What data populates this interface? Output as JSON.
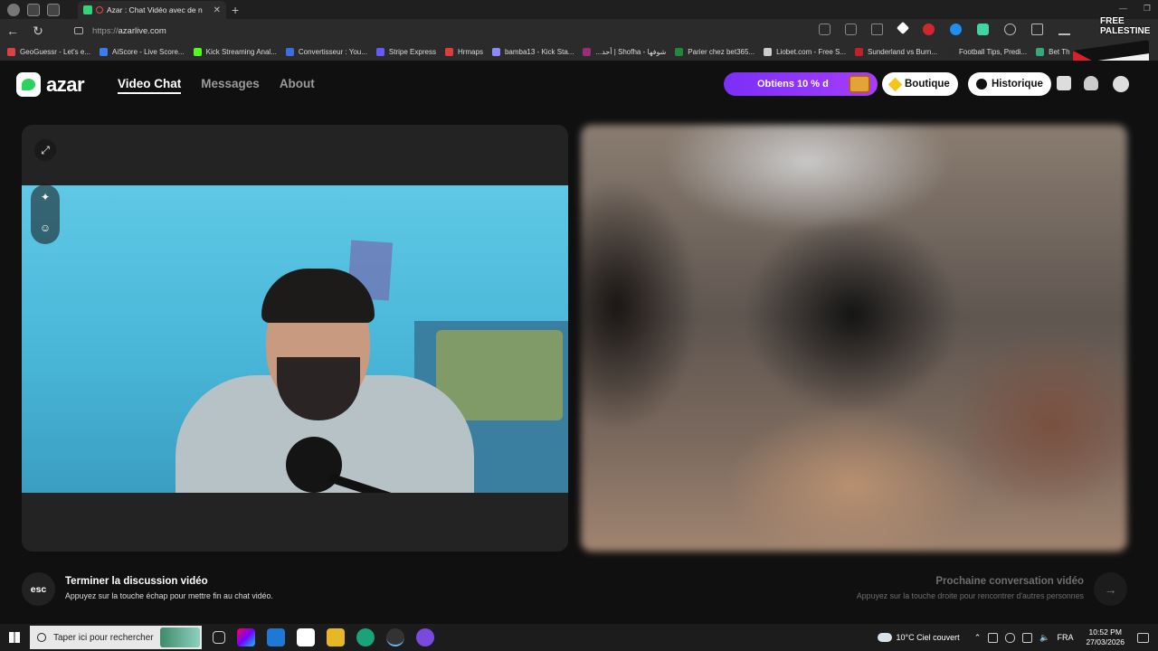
{
  "browser": {
    "tab_title": "Azar : Chat Vidéo avec de n",
    "new_tab_symbol": "+",
    "url_protocol": "https://",
    "url_host": "azarlive.com",
    "bookmarks": [
      {
        "label": "GeoGuessr - Let's e...",
        "color": "#e04040"
      },
      {
        "label": "AiScore - Live Score...",
        "color": "#3b7df0"
      },
      {
        "label": "Kick Streaming Anal...",
        "color": "#53fc18"
      },
      {
        "label": "Convertisseur : You...",
        "color": "#3a6ee8"
      },
      {
        "label": "Stripe Express",
        "color": "#635bff"
      },
      {
        "label": "Hrmaps",
        "color": "#e23b3b"
      },
      {
        "label": "bamba13 - Kick Sta...",
        "color": "#8a8aff"
      },
      {
        "label": "...أحد | Shofha - شوفها",
        "color": "#9c2b7a"
      },
      {
        "label": "Parier chez bet365...",
        "color": "#1f8a3a"
      },
      {
        "label": "Liobet.com - Free S...",
        "color": "#cccccc"
      },
      {
        "label": "Sunderland vs Burn...",
        "color": "#c21f2a"
      },
      {
        "label": "Football Tips, Predi...",
        "color": "#2a2a2a"
      },
      {
        "label": "Bet Th",
        "color": "#33aa77"
      }
    ],
    "badge_text": "FREE PALESTINE"
  },
  "app": {
    "brand": "azar",
    "nav": [
      {
        "label": "Video Chat",
        "active": true
      },
      {
        "label": "Messages",
        "active": false
      },
      {
        "label": "About",
        "active": false
      }
    ],
    "promo_label": "Obtiens 10 % d",
    "boutique_label": "Boutique",
    "historique_label": "Historique"
  },
  "footer": {
    "esc_key": "esc",
    "end_title": "Terminer la discussion vidéo",
    "end_sub": "Appuyez sur la touche échap pour mettre fin au chat vidéo.",
    "next_title": "Prochaine conversation vidéo",
    "next_sub": "Appuyez sur la touche droite pour rencontrer d'autres personnes",
    "next_arrow": "→"
  },
  "taskbar": {
    "search_placeholder": "Taper ici pour rechercher",
    "weather": "10°C  Ciel couvert",
    "language": "FRA",
    "time": "10:52 PM",
    "date": "27/03/2026"
  }
}
